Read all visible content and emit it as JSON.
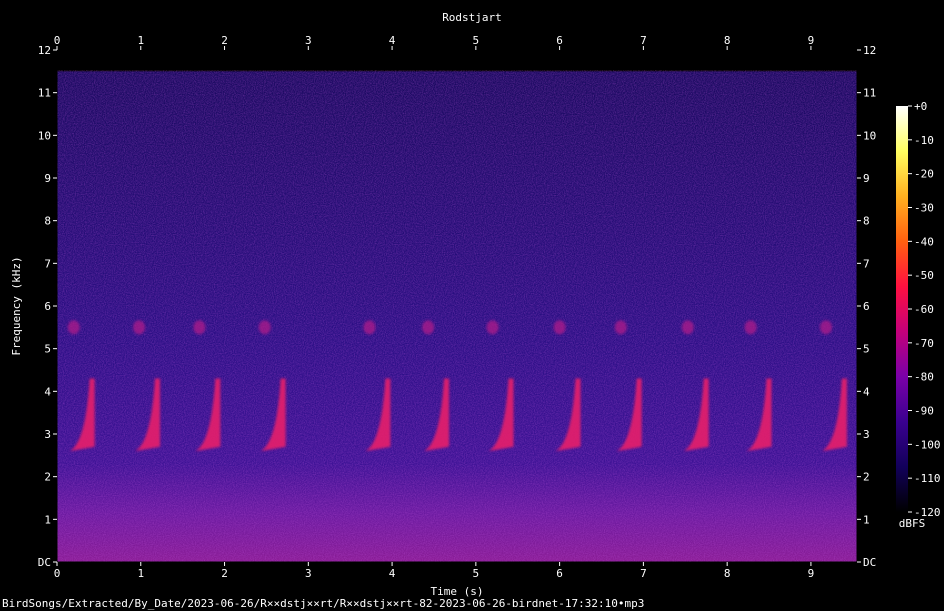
{
  "chart_data": {
    "type": "heatmap",
    "title": "Rodstjart",
    "xlabel": "Time (s)",
    "ylabel": "Frequency (kHz)",
    "xlim": [
      0,
      9.55
    ],
    "ylim": [
      0,
      12
    ],
    "x_ticks": [
      "0",
      "1",
      "2",
      "3",
      "4",
      "5",
      "6",
      "7",
      "8",
      "9"
    ],
    "y_ticks": [
      "DC",
      "1",
      "2",
      "3",
      "4",
      "5",
      "6",
      "7",
      "8",
      "9",
      "10",
      "11",
      "12"
    ],
    "colorbar": {
      "label": "dBFS",
      "range": [
        -120,
        0
      ],
      "ticks": [
        "+0",
        "-10",
        "-20",
        "-30",
        "-40",
        "-50",
        "-60",
        "-70",
        "-80",
        "-90",
        "-100",
        "-110",
        "-120"
      ],
      "colors": [
        "#000000",
        "#12005a",
        "#3a0090",
        "#7a00a8",
        "#c4007a",
        "#ff1040",
        "#ff6010",
        "#ffb020",
        "#ffff60",
        "#ffffff"
      ]
    },
    "call_onsets_s": [
      0.32,
      1.1,
      1.82,
      2.6,
      3.85,
      4.55,
      5.32,
      6.12,
      6.85,
      7.65,
      8.4,
      9.3
    ]
  },
  "footer_text": "BirdSongs/Extracted/By_Date/2023-06-26/R××dstj××rt/R××dstj××rt-82-2023-06-26-birdnet-17:32:10•mp3"
}
